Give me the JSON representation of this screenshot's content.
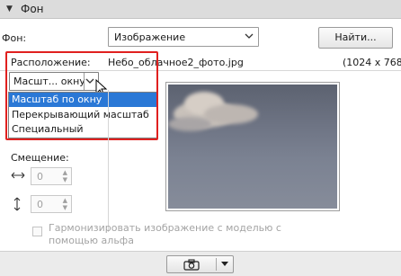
{
  "section": {
    "title": "Фон"
  },
  "background": {
    "label": "Фон:",
    "selected": "Изображение",
    "browse_button": "Найти..."
  },
  "placement": {
    "label": "Расположение:",
    "selected": "Масшт... окну",
    "options": [
      "Масштаб по окну",
      "Перекрывающий масштаб",
      "Специальный"
    ],
    "selected_index": 0
  },
  "file": {
    "name": "Небо_облачное2_фото.jpg",
    "dimensions": "(1024 x 768)"
  },
  "offset": {
    "label": "Смещение:",
    "x": "0",
    "y": "0"
  },
  "harmonize": {
    "label_line1": "Гармонизировать изображение с моделью с",
    "label_line2": "помощью альфа"
  },
  "icons": {
    "collapse": "triangle-down-icon",
    "dropdown": "chevron-down-icon",
    "horizontal": "horizontal-arrows-icon",
    "vertical": "vertical-arrows-icon",
    "camera": "camera-icon"
  },
  "colors": {
    "highlight": "#e0201f",
    "selection": "#2a78d6"
  }
}
